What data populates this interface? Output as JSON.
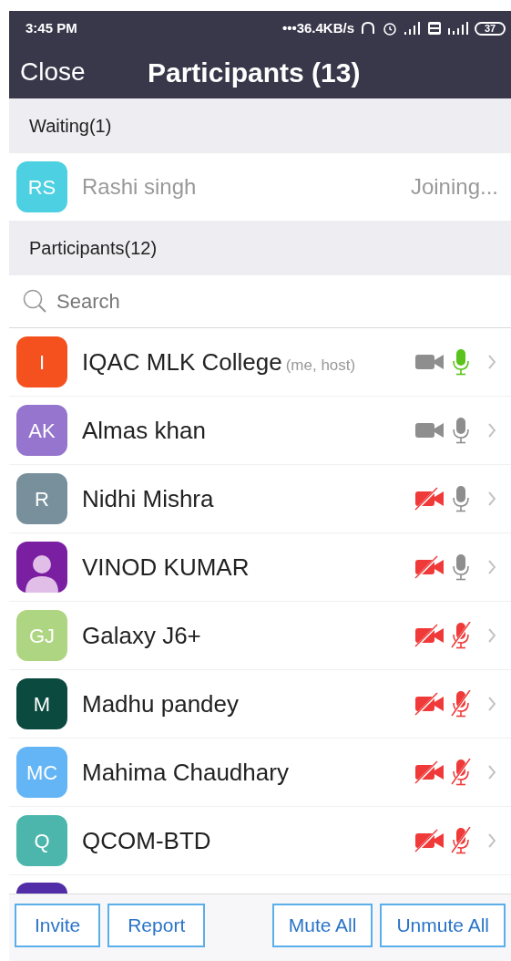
{
  "status_bar": {
    "time": "3:45 PM",
    "speed": "•••36.4KB/s",
    "battery": "37"
  },
  "header": {
    "close": "Close",
    "title": "Participants (13)"
  },
  "waiting": {
    "heading": "Waiting(1)",
    "items": [
      {
        "initials": "RS",
        "name": "Rashi singh",
        "status": "Joining...",
        "color": "#4dd0e1"
      }
    ]
  },
  "participants": {
    "heading": "Participants(12)",
    "search": {
      "placeholder": "Search"
    },
    "items": [
      {
        "kind": "initials",
        "initials": "I",
        "name": "IQAC MLK College",
        "note": "(me, host)",
        "color": "#f4511e",
        "video_on": true,
        "muted": false,
        "speaking": true
      },
      {
        "kind": "initials",
        "initials": "AK",
        "name": "Almas khan",
        "color": "#9575cd",
        "video_on": true,
        "muted": false,
        "speaking": false
      },
      {
        "kind": "initials",
        "initials": "R",
        "name": "Nidhi Mishra",
        "color": "#78909c",
        "video_on": false,
        "muted": false,
        "speaking": false
      },
      {
        "kind": "silhouette",
        "name": "VINOD KUMAR",
        "color": "#7b1fa2",
        "video_on": false,
        "muted": false,
        "speaking": false
      },
      {
        "kind": "initials",
        "initials": "GJ",
        "name": "Galaxy J6+",
        "color": "#aed581",
        "video_on": false,
        "muted": true,
        "speaking": false
      },
      {
        "kind": "initials",
        "initials": "M",
        "name": "Madhu pandey",
        "color": "#0b4a3e",
        "video_on": false,
        "muted": true,
        "speaking": false
      },
      {
        "kind": "initials",
        "initials": "MC",
        "name": "Mahima Chaudhary",
        "color": "#64b5f6",
        "video_on": false,
        "muted": true,
        "speaking": false
      },
      {
        "kind": "initials",
        "initials": "Q",
        "name": "QCOM-BTD",
        "color": "#4db6ac",
        "video_on": false,
        "muted": true,
        "speaking": false
      }
    ],
    "partial_row": {
      "color": "#512da8"
    }
  },
  "footer": {
    "left": [
      "Invite",
      "Report"
    ],
    "right": [
      "Mute All",
      "Unmute All"
    ]
  }
}
